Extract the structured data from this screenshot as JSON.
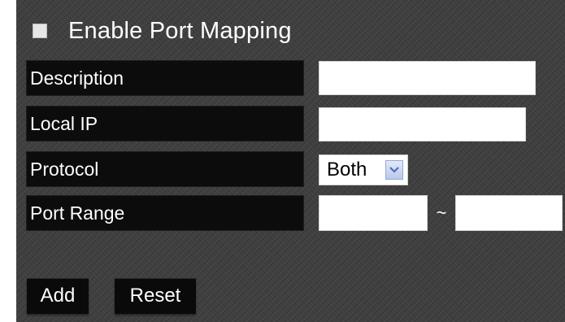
{
  "port_mapping": {
    "enable_label": "Enable Port Mapping",
    "enable_checked": false,
    "fields": {
      "description": {
        "label": "Description",
        "value": ""
      },
      "local_ip": {
        "label": "Local IP",
        "value": ""
      },
      "protocol": {
        "label": "Protocol",
        "selected": "Both"
      },
      "port_range": {
        "label": "Port Range",
        "start": "",
        "end": "",
        "separator": "~"
      }
    },
    "buttons": {
      "add": "Add",
      "reset": "Reset"
    }
  },
  "colors": {
    "panel_bg": "#3d3d3d",
    "label_bg": "#0c0c0c",
    "text": "#ffffff",
    "input_bg": "#ffffff",
    "select_arrow": "#b9c9ea"
  },
  "icons": {
    "select_arrow": "chevron-down-icon"
  }
}
